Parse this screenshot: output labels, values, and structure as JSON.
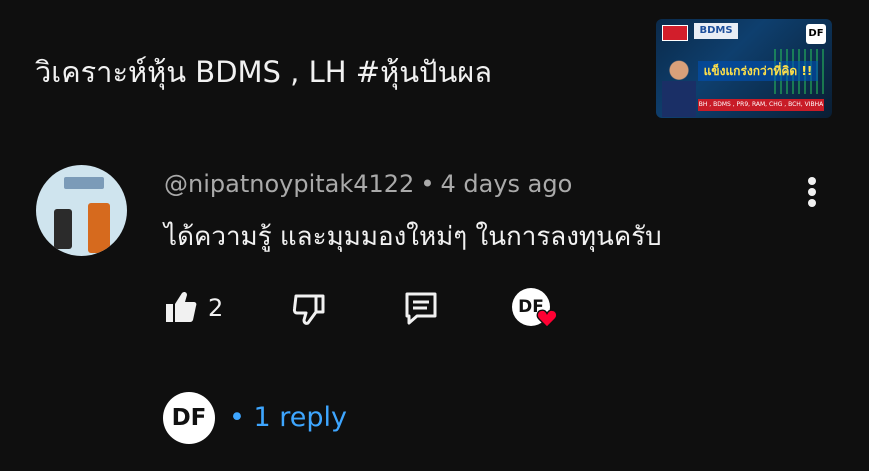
{
  "video": {
    "title": "วิเคราะห์หุ้น BDMS , LH #หุ้นปันผล",
    "thumbnail": {
      "brand": "BDMS",
      "corner_badge": "DF",
      "headline": "แข็งแกร่งกว่าที่คิด !!",
      "ticker": "BH , BDMS , PR9, RAM, CHG , BCH, VIBHA"
    }
  },
  "comment": {
    "author": "@nipatnoypitak4122",
    "separator": "•",
    "time": "4 days ago",
    "text": "ได้ความรู้ และมุมมองใหม่ๆ ในการลงทุนครับ",
    "like_count": "2",
    "creator_heart_initials": "DF"
  },
  "replies": {
    "avatar_initials": "DF",
    "label": "• 1 reply"
  },
  "colors": {
    "background": "#0f0f0f",
    "primary_text": "#f1f1f1",
    "secondary_text": "#aaaaaa",
    "link": "#3ea6ff",
    "heart": "#ff0033"
  },
  "icons": {
    "like": "thumbs-up-icon",
    "dislike": "thumbs-down-icon",
    "reply": "comment-icon",
    "more": "more-vert-icon",
    "heart": "heart-icon"
  }
}
